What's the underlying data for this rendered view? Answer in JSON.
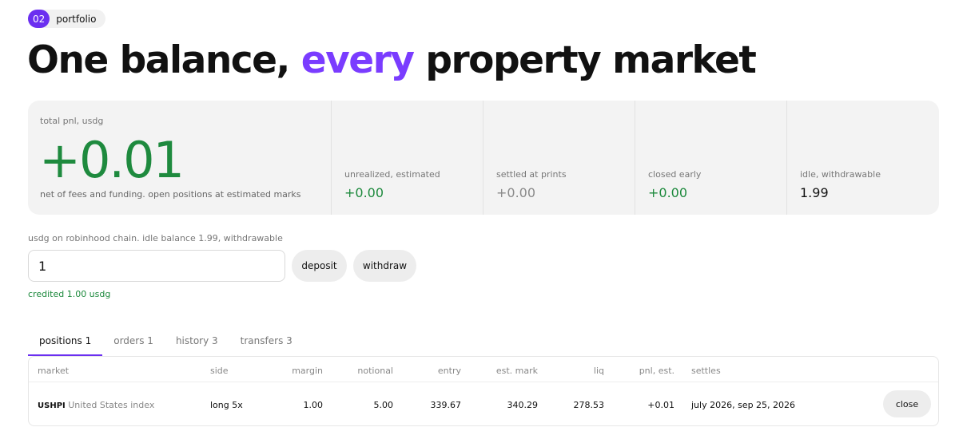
{
  "breadcrumb": {
    "number": "02",
    "label": "portfolio"
  },
  "title": {
    "before": "One balance, ",
    "accent": "every",
    "after": " property market"
  },
  "colors": {
    "accent": "#7a3cff",
    "positive": "#1e8a3e",
    "panel": "#f3f3f3"
  },
  "summary": {
    "total_label": "total pnl, usdg",
    "total_value": "+0.01",
    "total_note": "net of fees and funding. open positions at estimated marks",
    "stats": [
      {
        "label": "unrealized, estimated",
        "value": "+0.00"
      },
      {
        "label": "settled at prints",
        "value": "+0.00"
      },
      {
        "label": "closed early",
        "value": "+0.00"
      },
      {
        "label": "idle, withdrawable",
        "value": "1.99"
      }
    ]
  },
  "funding": {
    "note": "usdg on robinhood chain. idle balance 1.99, withdrawable",
    "amount_value": "1",
    "deposit_label": "deposit",
    "withdraw_label": "withdraw",
    "status": "credited 1.00 usdg"
  },
  "tabs": [
    {
      "label": "positions 1",
      "active": true
    },
    {
      "label": "orders 1",
      "active": false
    },
    {
      "label": "history 3",
      "active": false
    },
    {
      "label": "transfers 3",
      "active": false
    }
  ],
  "positions": {
    "columns": [
      "market",
      "side",
      "margin",
      "notional",
      "entry",
      "est. mark",
      "liq",
      "pnl, est.",
      "settles"
    ],
    "rows": [
      {
        "symbol": "USHPI",
        "market_name": "United States index",
        "side": "long 5x",
        "margin": "1.00",
        "notional": "5.00",
        "entry": "339.67",
        "est_mark": "340.29",
        "liq": "278.53",
        "pnl": "+0.01",
        "settles": "july 2026, sep 25, 2026",
        "action_label": "close"
      }
    ]
  }
}
